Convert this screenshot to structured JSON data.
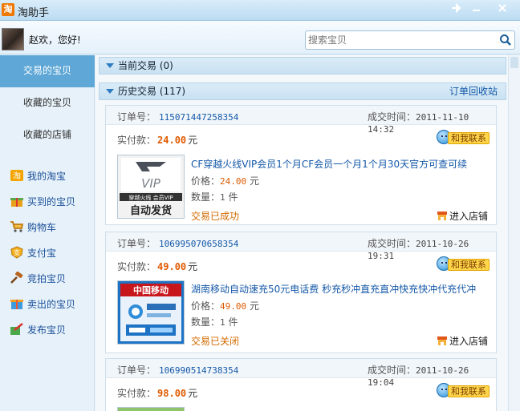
{
  "window": {
    "app_icon_label": "淘",
    "title": "淘助手"
  },
  "user": {
    "greeting": "赵欢，您好!"
  },
  "search": {
    "placeholder": "搜索宝贝"
  },
  "sidebar": {
    "tabs": [
      {
        "label": "交易的宝贝",
        "active": true
      },
      {
        "label": "收藏的宝贝",
        "active": false
      },
      {
        "label": "收藏的店铺",
        "active": false
      }
    ],
    "links": [
      {
        "label": "我的淘宝",
        "icon": "taobao-icon"
      },
      {
        "label": "买到的宝贝",
        "icon": "gift-icon"
      },
      {
        "label": "购物车",
        "icon": "cart-icon"
      },
      {
        "label": "支付宝",
        "icon": "alipay-icon"
      },
      {
        "label": "竞拍宝贝",
        "icon": "auction-hammer-icon"
      },
      {
        "label": "卖出的宝贝",
        "icon": "box-icon"
      },
      {
        "label": "发布宝贝",
        "icon": "publish-icon"
      }
    ]
  },
  "sections": {
    "current": {
      "label": "当前交易 (0)"
    },
    "history": {
      "label": "历史交易 (117)",
      "recycle_link": "订单回收站"
    }
  },
  "labels": {
    "order_no": "订单号：",
    "deal_time": "成交时间：",
    "paid": "实付款：",
    "currency": "元",
    "contact": "和我联系",
    "enter_shop": "进入店铺",
    "price": "价格：",
    "qty": "数量：",
    "qty_unit": "件"
  },
  "orders": [
    {
      "order_no": "115071447258354",
      "deal_time": "2011-11-10 14:32",
      "paid": "24.00",
      "title": "CF穿越火线VIP会员1个月CF会员一个月1个月30天官方可查可续",
      "price": "24.00",
      "qty": "1",
      "status": "交易已成功",
      "thumb_text": [
        "VIP",
        "穿越火线 会员VIP",
        "自动发货"
      ]
    },
    {
      "order_no": "106995070658354",
      "deal_time": "2011-10-26 19:31",
      "paid": "49.00",
      "title": "湖南移动自动速充50元电话费 秒充秒冲直充直冲快充快冲代充代冲",
      "price": "49.00",
      "qty": "1",
      "status": "交易已关闭",
      "thumb_text": [
        "中国移动"
      ]
    },
    {
      "order_no": "106990514738354",
      "deal_time": "2011-10-26 19:04",
      "paid": "98.00"
    }
  ],
  "colors": {
    "accent": "#5ea7d6",
    "link": "#1458a8",
    "price": "#e05a00",
    "status": "#d26a00"
  }
}
